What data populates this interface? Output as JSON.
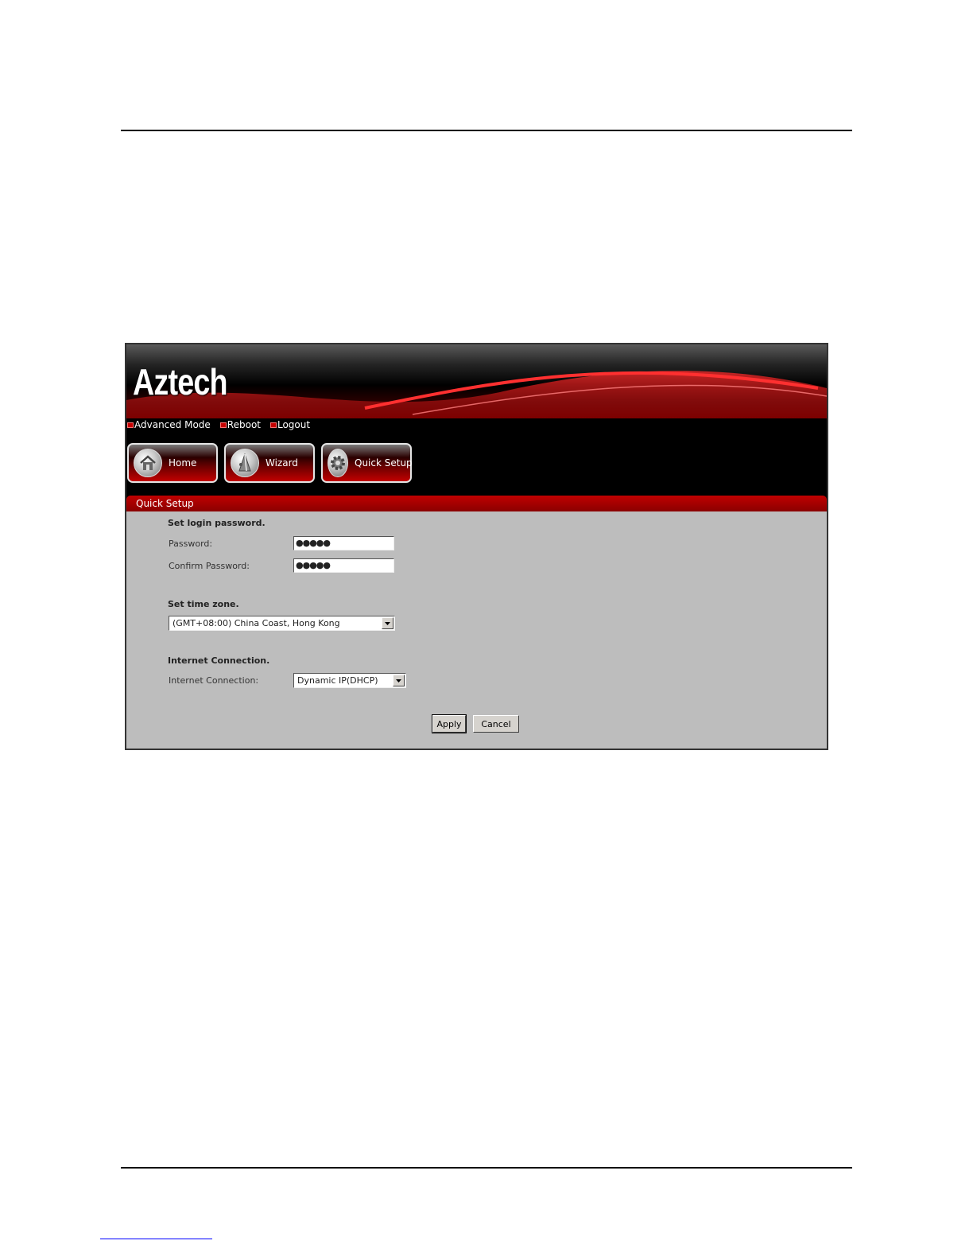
{
  "app": {
    "logo": "Aztech"
  },
  "toplinks": [
    "Advanced Mode",
    "Reboot",
    "Logout"
  ],
  "nav": [
    {
      "label": "Home",
      "icon": "home-icon"
    },
    {
      "label": "Wizard",
      "icon": "wizard-icon"
    },
    {
      "label": "Quick Setup",
      "icon": "gear-icon"
    }
  ],
  "panel": {
    "title": "Quick Setup",
    "login": {
      "heading": "Set login password.",
      "password_label": "Password:",
      "password_value": "●●●●●",
      "confirm_label": "Confirm Password:",
      "confirm_value": "●●●●●"
    },
    "timezone": {
      "heading": "Set time zone.",
      "selected": "(GMT+08:00) China Coast, Hong Kong"
    },
    "internet": {
      "heading": "Internet Connection.",
      "label": "Internet Connection:",
      "selected": "Dynamic IP(DHCP)"
    },
    "apply_label": "Apply",
    "cancel_label": "Cancel"
  },
  "colors": {
    "brand_red": "#c00000",
    "panel_bg": "#bdbdbd"
  }
}
